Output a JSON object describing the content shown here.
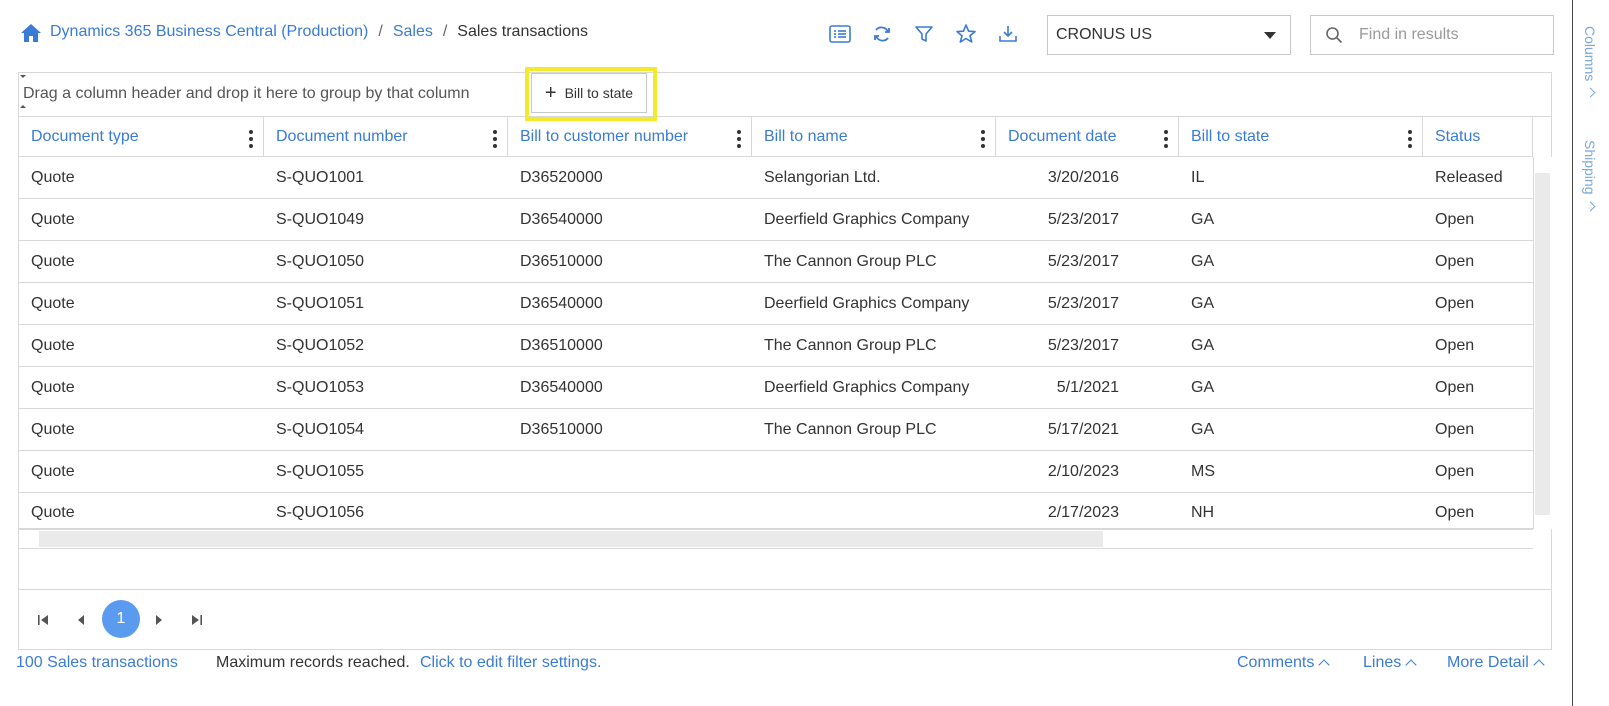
{
  "breadcrumb": {
    "root": "Dynamics 365 Business Central (Production)",
    "sep1": "/",
    "section": "Sales",
    "sep2": "/",
    "current": "Sales transactions"
  },
  "toolbar": {
    "icons": [
      "list-icon",
      "refresh-icon",
      "filter-icon",
      "star-icon",
      "download-icon"
    ]
  },
  "company": {
    "selected": "CRONUS US"
  },
  "search": {
    "placeholder": "Find in results",
    "value": ""
  },
  "rail": {
    "columns": "Columns",
    "shipping": "Shipping"
  },
  "grouping": {
    "hint": "Drag a column header and drop it here to group by that column",
    "chip_label": "Bill to state",
    "highlight_color": "#f2ea2a"
  },
  "columns": [
    "Document type",
    "Document number",
    "Bill to customer number",
    "Bill to name",
    "Document date",
    "Bill to state",
    "Status"
  ],
  "rows": [
    [
      "Quote",
      "S-QUO1001",
      "D36520000",
      "Selangorian Ltd.",
      "3/20/2016",
      "IL",
      "Released"
    ],
    [
      "Quote",
      "S-QUO1049",
      "D36540000",
      "Deerfield Graphics Company",
      "5/23/2017",
      "GA",
      "Open"
    ],
    [
      "Quote",
      "S-QUO1050",
      "D36510000",
      "The Cannon Group PLC",
      "5/23/2017",
      "GA",
      "Open"
    ],
    [
      "Quote",
      "S-QUO1051",
      "D36540000",
      "Deerfield Graphics Company",
      "5/23/2017",
      "GA",
      "Open"
    ],
    [
      "Quote",
      "S-QUO1052",
      "D36510000",
      "The Cannon Group PLC",
      "5/23/2017",
      "GA",
      "Open"
    ],
    [
      "Quote",
      "S-QUO1053",
      "D36540000",
      "Deerfield Graphics Company",
      "5/1/2021",
      "GA",
      "Open"
    ],
    [
      "Quote",
      "S-QUO1054",
      "D36510000",
      "The Cannon Group PLC",
      "5/17/2021",
      "GA",
      "Open"
    ],
    [
      "Quote",
      "S-QUO1055",
      "",
      "",
      "2/10/2023",
      "MS",
      "Open"
    ],
    [
      "Quote",
      "S-QUO1056",
      "",
      "",
      "2/17/2023",
      "NH",
      "Open"
    ]
  ],
  "pager": {
    "current_page": "1"
  },
  "footer": {
    "count": "100 Sales transactions",
    "max_reached": "Maximum records reached.",
    "edit_filter": "Click to edit filter settings.",
    "comments": "Comments",
    "lines": "Lines",
    "more_detail": "More Detail"
  },
  "colors": {
    "accent": "#3a7bd5",
    "page_bubble": "#5b9bef"
  }
}
